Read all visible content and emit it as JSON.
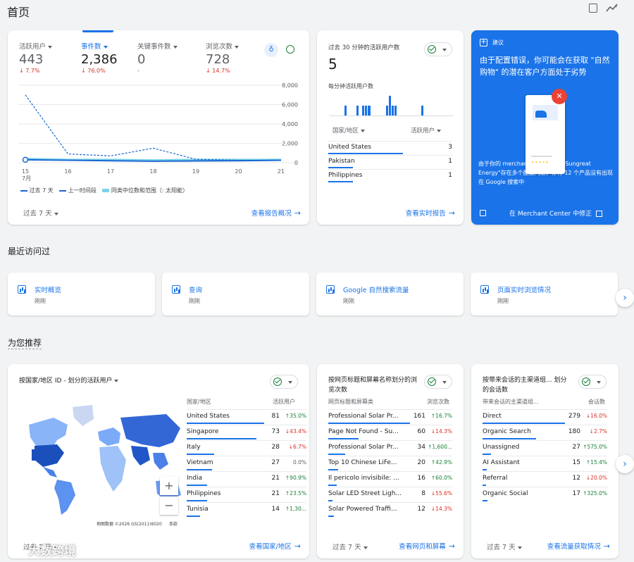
{
  "page": {
    "title": "首页"
  },
  "overview": {
    "metrics": [
      {
        "label": "活跃用户",
        "value": "443",
        "change": "7.7%",
        "dir": "down"
      },
      {
        "label": "事件数",
        "value": "2,386",
        "change": "76.0%",
        "dir": "down"
      },
      {
        "label": "关键事件数",
        "value": "0",
        "change": "-",
        "dir": "none"
      },
      {
        "label": "浏览次数",
        "value": "728",
        "change": "14.7%",
        "dir": "down"
      }
    ],
    "y_ticks": [
      "8,000",
      "6,000",
      "4,000",
      "2,000",
      "0"
    ],
    "x_ticks": [
      "15",
      "16",
      "17",
      "18",
      "19",
      "20",
      "21"
    ],
    "x_sub": "7月",
    "legend": [
      "过去 7 天",
      "上一时间段",
      "同类中位数和范围（: 太阳能）"
    ],
    "period": "过去 7 天",
    "link": "查看报告概况"
  },
  "chart_data": {
    "type": "line",
    "categories": [
      "15",
      "16",
      "17",
      "18",
      "19",
      "20",
      "21"
    ],
    "ylim": [
      0,
      8000
    ],
    "series": [
      {
        "name": "过去 7 天",
        "values": [
          300,
          250,
          200,
          150,
          180,
          200,
          250
        ]
      },
      {
        "name": "上一时间段",
        "values": [
          7000,
          900,
          700,
          1500,
          350,
          250,
          250
        ]
      },
      {
        "name": "同类中位数和范围（: 太阳能）",
        "values": [
          400,
          300,
          300,
          250,
          300,
          300,
          300
        ]
      }
    ]
  },
  "realtime": {
    "title": "过去 30 分钟的活跃用户数",
    "value": "5",
    "sub": "每分钟活跃用户数",
    "bars": [
      0,
      0,
      0,
      0,
      0,
      1,
      0,
      0,
      0,
      1,
      0,
      1,
      1,
      1,
      0,
      0,
      0,
      0,
      0,
      1,
      2,
      1,
      1,
      0,
      0,
      0,
      0,
      0,
      0,
      0,
      0,
      1,
      0,
      0,
      0,
      0,
      0,
      0,
      0,
      0,
      0,
      0
    ],
    "col1": "国家/地区",
    "col2": "活跃用户",
    "rows": [
      {
        "name": "United States",
        "value": "3",
        "share": 0.6
      },
      {
        "name": "Pakistan",
        "value": "1",
        "share": 0.2
      },
      {
        "name": "Philippines",
        "value": "1",
        "share": 0.2
      }
    ],
    "link": "查看实时报告"
  },
  "suggest": {
    "tag": "建议",
    "headline": "由于配置错误，你可能会在获取 \"自然购物\" 的潜在客户方面处于劣势",
    "body": "由于你的 merchant center 账号\"Sungreat Energy\"存在多个配置问题，你有 12 个产品没有出现在 Google 搜索中",
    "action": "在 Merchant Center 中修正",
    "stars": "★★★★★"
  },
  "recent": {
    "title": "最近访问过",
    "items": [
      {
        "label": "实时概览",
        "time": "刚刚"
      },
      {
        "label": "查询",
        "time": "刚刚"
      },
      {
        "label": "Google 自然搜索流量",
        "time": "刚刚"
      },
      {
        "label": "页面实时浏览情况",
        "time": "刚刚"
      }
    ]
  },
  "recommend": {
    "title": "为您推荐"
  },
  "country_card": {
    "title": "按国家/地区 ID - 划分的活跃用户",
    "col1": "国家/地区",
    "col2": "活跃用户",
    "rows": [
      {
        "name": "United States",
        "value": "81",
        "change": "35.0%",
        "dir": "up",
        "share": 1.0
      },
      {
        "name": "Singapore",
        "value": "73",
        "change": "43.4%",
        "dir": "down",
        "share": 0.9
      },
      {
        "name": "Italy",
        "value": "28",
        "change": "6.7%",
        "dir": "down",
        "share": 0.35
      },
      {
        "name": "Vietnam",
        "value": "27",
        "change": "0.0%",
        "dir": "none",
        "share": 0.33
      },
      {
        "name": "India",
        "value": "21",
        "change": "90.9%",
        "dir": "up",
        "share": 0.26
      },
      {
        "name": "Philippines",
        "value": "21",
        "change": "23.5%",
        "dir": "up",
        "share": 0.26
      },
      {
        "name": "Tunisia",
        "value": "14",
        "change": "1,30...",
        "dir": "up",
        "share": 0.17
      }
    ],
    "map_credit": "地图数据 ©2026 GS(2011)6020",
    "map_terms": "条款",
    "zoom_in": "+",
    "zoom_out": "−",
    "period": "过去 7 天",
    "link": "查看国家/地区"
  },
  "pages_card": {
    "title": "按网页标题和屏幕名称划分的浏览次数",
    "col1": "网页标题和屏幕类",
    "col2": "浏览次数",
    "rows": [
      {
        "name": "Professional Solar Pr...",
        "value": "161",
        "change": "16.7%",
        "dir": "up",
        "share": 1.0
      },
      {
        "name": "Page Not Found - Su...",
        "value": "60",
        "change": "14.3%",
        "dir": "down",
        "share": 0.37
      },
      {
        "name": "Professional Solar Pr...",
        "value": "34",
        "change": "1,600...",
        "dir": "up",
        "share": 0.21
      },
      {
        "name": "Top 10 Chinese LiFe...",
        "value": "20",
        "change": "42.9%",
        "dir": "up",
        "share": 0.12
      },
      {
        "name": "Il pericolo invisibile: ...",
        "value": "16",
        "change": "60.0%",
        "dir": "up",
        "share": 0.1
      },
      {
        "name": "Solar LED Street Ligh...",
        "value": "8",
        "change": "55.6%",
        "dir": "down",
        "share": 0.05
      },
      {
        "name": "Solar Powered Traffi...",
        "value": "12",
        "change": "14.3%",
        "dir": "down",
        "share": 0.07
      }
    ],
    "period": "过去 7 天",
    "link": "查看网页和屏幕"
  },
  "channel_card": {
    "title": "按带来会话的主渠道组... 划分的会话数",
    "col1": "带来会话的主渠道组...",
    "col2": "会话数",
    "rows": [
      {
        "name": "Direct",
        "value": "279",
        "change": "16.0%",
        "dir": "down",
        "share": 1.0
      },
      {
        "name": "Organic Search",
        "value": "180",
        "change": "2.7%",
        "dir": "down",
        "share": 0.65
      },
      {
        "name": "Unassigned",
        "value": "27",
        "change": "575.0%",
        "dir": "up",
        "share": 0.1
      },
      {
        "name": "AI Assistant",
        "value": "15",
        "change": "15.4%",
        "dir": "up",
        "share": 0.05
      },
      {
        "name": "Referral",
        "value": "12",
        "change": "20.0%",
        "dir": "down",
        "share": 0.04
      },
      {
        "name": "Organic Social",
        "value": "17",
        "change": "325.0%",
        "dir": "up",
        "share": 0.06
      }
    ],
    "period": "过去 7 天",
    "link": "查看流量获取情况"
  },
  "watermark": "大数跨境",
  "icons": [
    "insights-icon",
    "share-icon",
    "check-icon",
    "chevron-right-icon",
    "bar-chart-icon"
  ]
}
